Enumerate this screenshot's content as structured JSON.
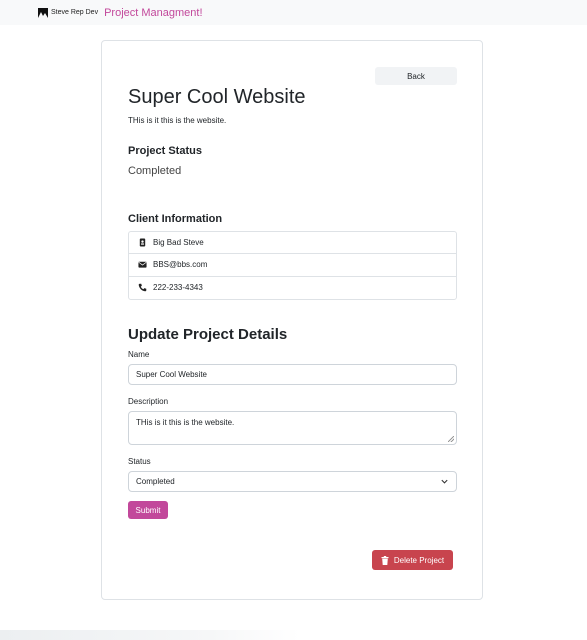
{
  "navbar": {
    "brand_text": "Steve Rep Dev",
    "title": "Project Managment!"
  },
  "project": {
    "back_label": "Back",
    "title": "Super Cool Website",
    "description": "THis is it this is the website.",
    "status_heading": "Project Status",
    "status_value": "Completed"
  },
  "client": {
    "heading": "Client Information",
    "name": "Big Bad Steve",
    "email": "BBS@bbs.com",
    "phone": "222-233-4343"
  },
  "form": {
    "heading": "Update Project Details",
    "name_label": "Name",
    "name_value": "Super Cool Website",
    "description_label": "Description",
    "description_value": "THis is it this is the website.",
    "status_label": "Status",
    "status_value": "Completed",
    "submit_label": "Submit",
    "delete_label": "Delete Project"
  },
  "colors": {
    "accent": "#c2489b",
    "danger": "#c8444e"
  }
}
